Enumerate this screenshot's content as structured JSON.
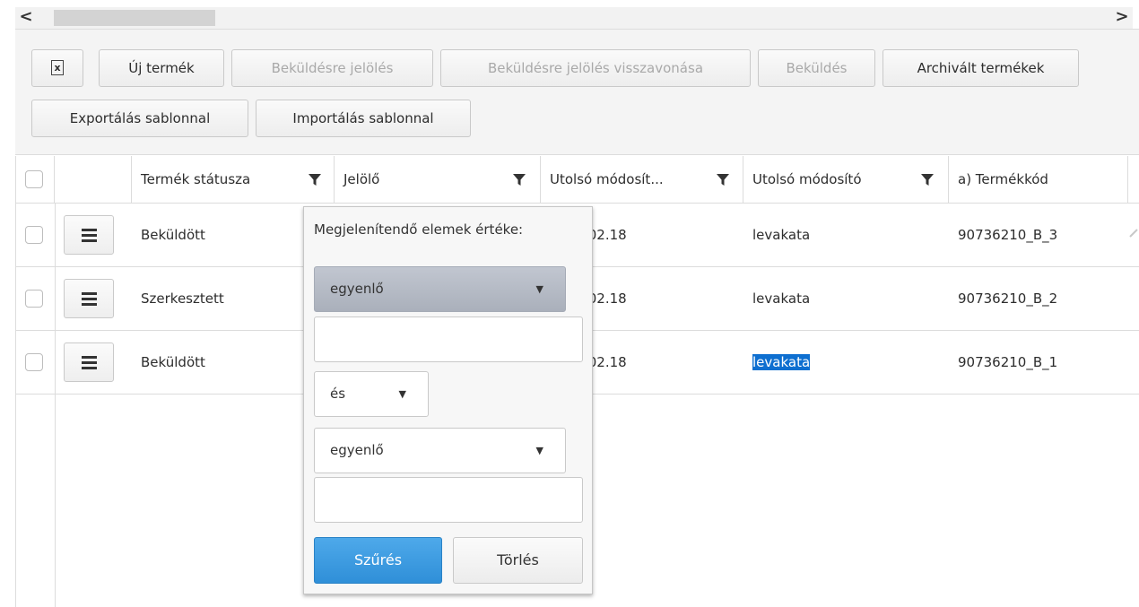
{
  "scrollbar": {
    "left_arrow": "<",
    "right_arrow": ">"
  },
  "toolbar": {
    "excel_glyph": "x",
    "new_product": "Új termék",
    "mark_for_submission": "Beküldésre jelölés",
    "revoke_marking": "Beküldésre jelölés visszavonása",
    "submit": "Beküldés",
    "archived_products": "Archivált termékek",
    "export_template": "Exportálás sablonnal",
    "import_template": "Importálás sablonnal"
  },
  "grid": {
    "columns": [
      "Termék státusza",
      "Jelölő",
      "Utolsó módosít...",
      "Utolsó módosító",
      "a) Termékkód"
    ],
    "rows": [
      {
        "status": "Beküldött",
        "date": ".02.18",
        "modifier": "levakata",
        "code": "90736210_B_3"
      },
      {
        "status": "Szerkesztett",
        "date": ".02.18",
        "modifier": "levakata",
        "code": "90736210_B_2"
      },
      {
        "status": "Beküldött",
        "date": ".02.18",
        "modifier": "levakata",
        "code": "90736210_B_1"
      }
    ]
  },
  "filter_popup": {
    "label": "Megjelenítendő elemek értéke:",
    "operator1": "egyenlő",
    "value1": "",
    "logic": "és",
    "operator2": "egyenlő",
    "value2": "",
    "filter_button": "Szűrés",
    "clear_button": "Törlés"
  },
  "colors": {
    "accent": "#2f8fd8",
    "selection": "#0e6fd0"
  }
}
